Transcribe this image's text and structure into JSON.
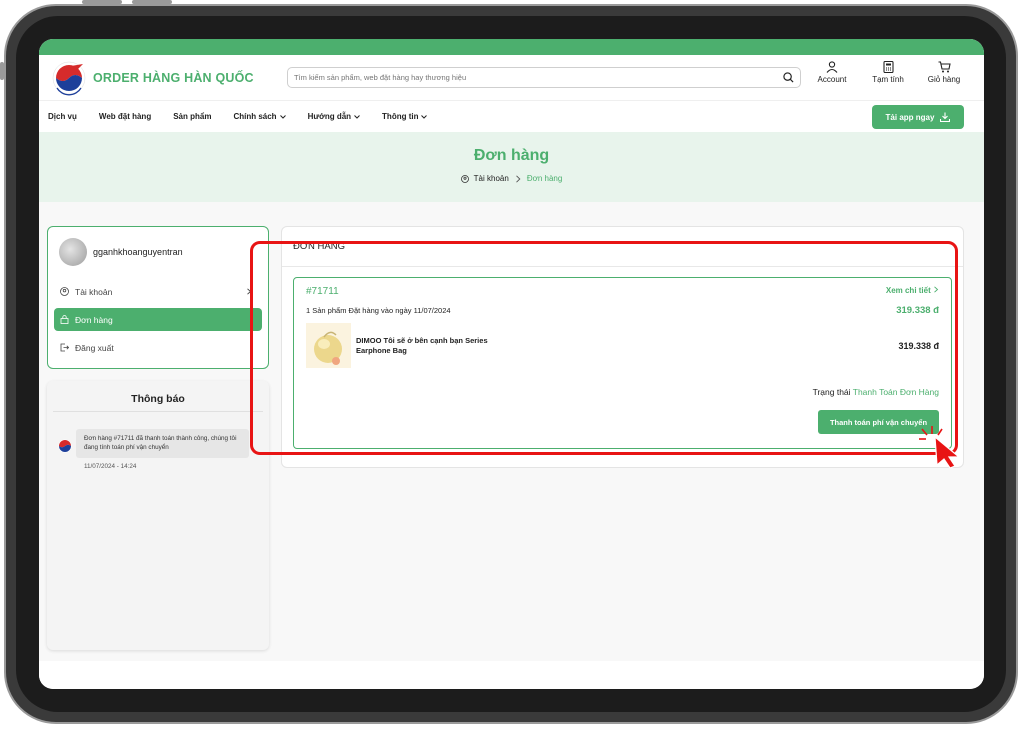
{
  "brand": {
    "name": "ORDER HÀNG HÀN QUỐC",
    "primary_color": "#4caf6e",
    "logo": "korea-logo-icon"
  },
  "search": {
    "placeholder": "Tìm kiếm sản phẩm, web đặt hàng hay thương hiệu"
  },
  "header_icons": [
    {
      "label": "Account",
      "icon": "user-icon"
    },
    {
      "label": "Tạm tính",
      "icon": "calculator-icon"
    },
    {
      "label": "Giỏ hàng",
      "icon": "cart-icon"
    }
  ],
  "nav": {
    "items": [
      {
        "label": "Dịch vụ",
        "dropdown": false
      },
      {
        "label": "Web đặt hàng",
        "dropdown": false
      },
      {
        "label": "Sản phẩm",
        "dropdown": false
      },
      {
        "label": "Chính sách",
        "dropdown": true
      },
      {
        "label": "Hướng dẫn",
        "dropdown": true
      },
      {
        "label": "Thông tin",
        "dropdown": true
      }
    ],
    "app_button": "Tải app ngay"
  },
  "hero": {
    "title": "Đơn hàng",
    "breadcrumb": [
      "Tài khoản",
      "Đơn hàng"
    ]
  },
  "sidebar": {
    "username": "gganhkhoanguyentran",
    "items": [
      {
        "label": "Tài khoản",
        "icon": "user-circle-icon",
        "active": false
      },
      {
        "label": "Đơn hàng",
        "icon": "bag-icon",
        "active": true
      },
      {
        "label": "Đăng xuất",
        "icon": "logout-icon",
        "active": false
      }
    ]
  },
  "notifications": {
    "title": "Thông báo",
    "items": [
      {
        "text": "Đơn hàng #71711 đã thanh toán thành công, chúng tôi đang tính toán phí vận chuyển",
        "time": "11/07/2024 - 14:24"
      }
    ]
  },
  "orders": {
    "title": "ĐƠN HÀNG",
    "list": [
      {
        "id": "#71711",
        "detail_link": "Xem chi tiết",
        "meta": "1 Sản phẩm  Đặt hàng vào ngày 11/07/2024",
        "total": "319.338 đ",
        "product_name_line1": "DIMOO Tôi sẽ ở bên cạnh bạn Series",
        "product_name_line2": "Earphone Bag",
        "product_price": "319.338 đ",
        "status_label": "Trạng thái",
        "status_value": "Thanh Toán Đơn Hàng",
        "action_button": "Thanh toán phí vận chuyển"
      }
    ]
  }
}
